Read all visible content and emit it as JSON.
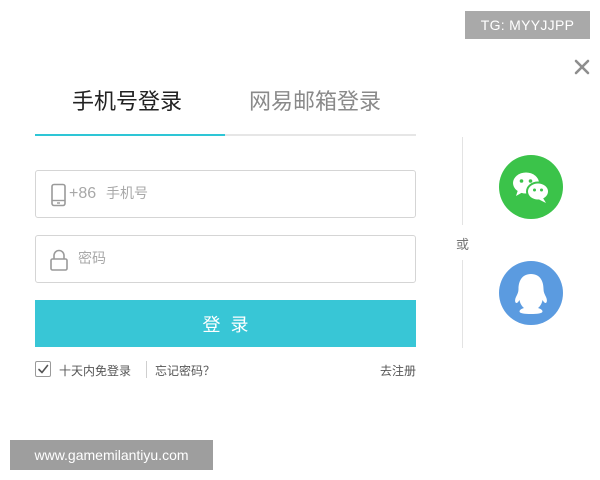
{
  "badge": {
    "text": "TG: MYYJJPP"
  },
  "tabs": [
    {
      "label": "手机号登录",
      "active": true
    },
    {
      "label": "网易邮箱登录",
      "active": false
    }
  ],
  "phone_field": {
    "country_code": "+86",
    "placeholder": "手机号",
    "value": ""
  },
  "password_field": {
    "placeholder": "密码",
    "value": ""
  },
  "login_button": {
    "label": "登录"
  },
  "options": {
    "remember_label": "十天内免登录",
    "remember_checked": true,
    "forgot_label": "忘记密码？",
    "register_label": "去注册"
  },
  "divider": {
    "or_label": "或"
  },
  "social": [
    {
      "name": "wechat",
      "icon": "wechat-icon",
      "color": "#3bc34a"
    },
    {
      "name": "qq",
      "icon": "qq-icon",
      "color": "#5b9be0"
    }
  ],
  "watermark": {
    "text": "www.gamemilantiyu.com"
  },
  "colors": {
    "accent": "#38c6d6",
    "tab_active": "#2ec6d6",
    "border": "#d5d5d5"
  }
}
